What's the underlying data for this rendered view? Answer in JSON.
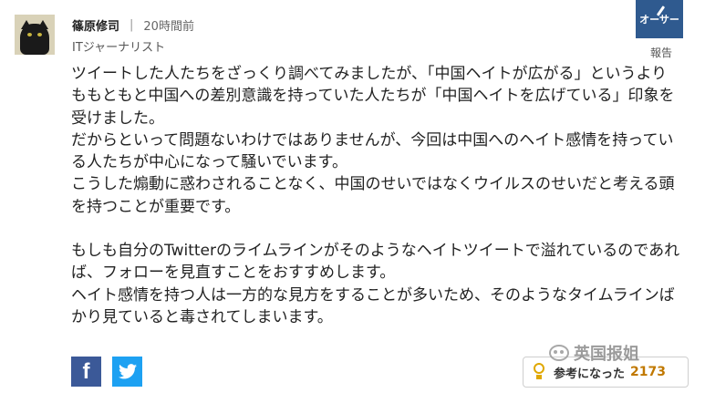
{
  "author": {
    "name": "篠原修司",
    "separator": "|",
    "time": "20時間前",
    "title": "ITジャーナリスト"
  },
  "badge": {
    "label": "オーサー",
    "icon": "pen-icon",
    "color": "#2f5a8f"
  },
  "report_label": "報告",
  "comment": {
    "paragraph1": "ツイートした人たちをざっくり調べてみましたが、「中国ヘイトが広がる」というよりももともと中国への差別意識を持っていた人たちが「中国ヘイトを広げている」印象を受けました。",
    "paragraph2": "だからといって問題ないわけではありませんが、今回は中国へのヘイト感情を持っている人たちが中心になって騒いでいます。",
    "paragraph3": "こうした煽動に惑わされることなく、中国のせいではなくウイルスのせいだと考える頭を持つことが重要です。",
    "paragraph4": "もしも自分のTwitterのライムラインがそのようなヘイトツイートで溢れているのであれば、フォローを見直すことをおすすめします。",
    "paragraph5": "ヘイト感情を持つ人は一方的な見方をすることが多いため、そのようなタイムラインばかり見ていると毒されてしまいます。"
  },
  "social": {
    "facebook": {
      "glyph": "f",
      "icon": "facebook-icon",
      "color": "#3b5998"
    },
    "twitter": {
      "glyph": "t",
      "icon": "twitter-icon",
      "color": "#1da1f2"
    }
  },
  "helpful": {
    "label": "参考になった",
    "count": "2173",
    "icon": "lightbulb-icon"
  },
  "watermark": {
    "text": "英国报姐"
  }
}
